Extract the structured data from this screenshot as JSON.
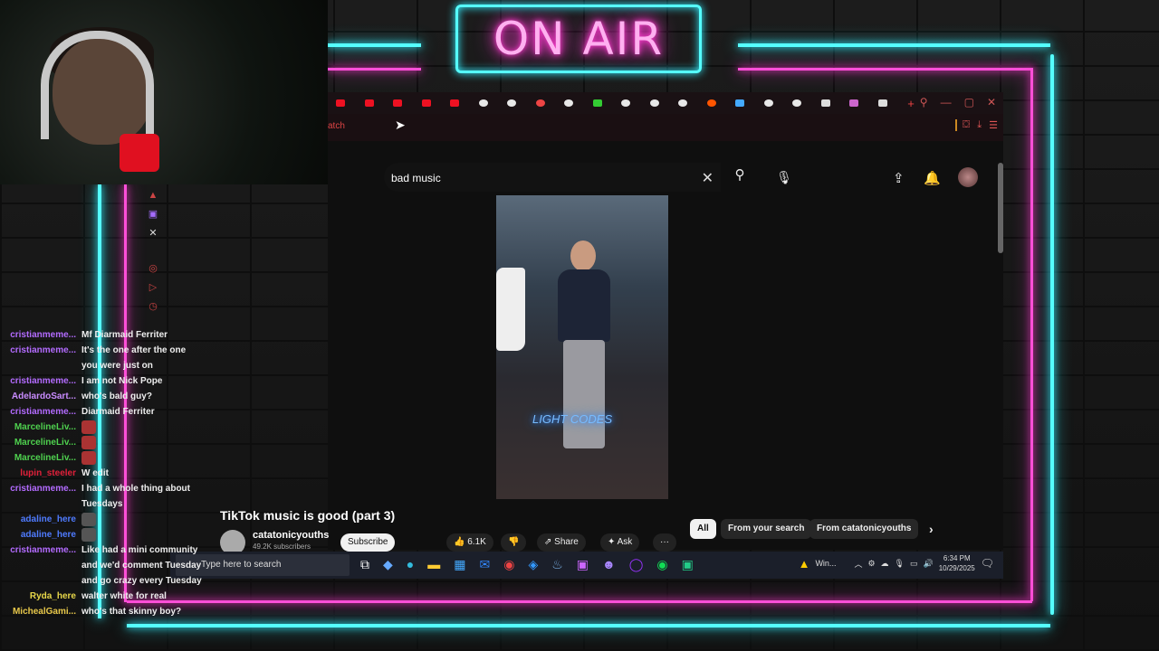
{
  "overlay": {
    "onair_text": "ON AIR"
  },
  "browser": {
    "url_fragment": "atch",
    "youtube": {
      "search_query": "bad music",
      "video_overlay_text": "LIGHT CODES",
      "video_title": "TikTok music is good (part 3)",
      "channel_name": "catatonicyouths",
      "subscribers": "49.2K subscribers",
      "subscribe_label": "Subscribe",
      "like_count": "6.1K",
      "share_label": "Share",
      "ask_label": "Ask",
      "chips": [
        "All",
        "From your search",
        "From catatonicyouths"
      ]
    }
  },
  "taskbar": {
    "search_placeholder": "Type here to search",
    "weather_label": "Win...",
    "time": "6:34 PM",
    "date": "10/29/2025"
  },
  "chat": {
    "messages": [
      {
        "user": "cristianmeme...",
        "color": "#b36bff",
        "text": "Mf Diarmaid Ferriter"
      },
      {
        "user": "cristianmeme...",
        "color": "#b36bff",
        "text": "It's the one after the one you were just on"
      },
      {
        "user": "cristianmeme...",
        "color": "#b36bff",
        "text": "I am not Nick Pope"
      },
      {
        "user": "AdelardoSart...",
        "color": "#c98cff",
        "text": "who's bald guy?"
      },
      {
        "user": "cristianmeme...",
        "color": "#b36bff",
        "text": "Diarmaid Ferriter"
      },
      {
        "user": "MarcelineLiv...",
        "color": "#4fd24f",
        "text": ""
      },
      {
        "user": "MarcelineLiv...",
        "color": "#4fd24f",
        "text": ""
      },
      {
        "user": "MarcelineLiv...",
        "color": "#4fd24f",
        "text": ""
      },
      {
        "user": "lupin_steeler",
        "color": "#e0203a",
        "text": "W edit"
      },
      {
        "user": "cristianmeme...",
        "color": "#b36bff",
        "text": "I had a whole thing about Tuesdays"
      },
      {
        "user": "adaline_here",
        "color": "#4f7bff",
        "text": ""
      },
      {
        "user": "adaline_here",
        "color": "#4f7bff",
        "text": ""
      },
      {
        "user": "cristianmeme...",
        "color": "#b36bff",
        "text": "Like had a mini community and we'd comment Tuesday and go crazy every Tuesday"
      },
      {
        "user": "Ryda_here",
        "color": "#e8d84a",
        "text": "walter white for real"
      },
      {
        "user": "MichealGami...",
        "color": "#e8c84a",
        "text": "who's that skinny boy?"
      }
    ]
  },
  "colors": {
    "neon_cyan": "#55ffff",
    "neon_magenta": "#ff4fd8"
  }
}
